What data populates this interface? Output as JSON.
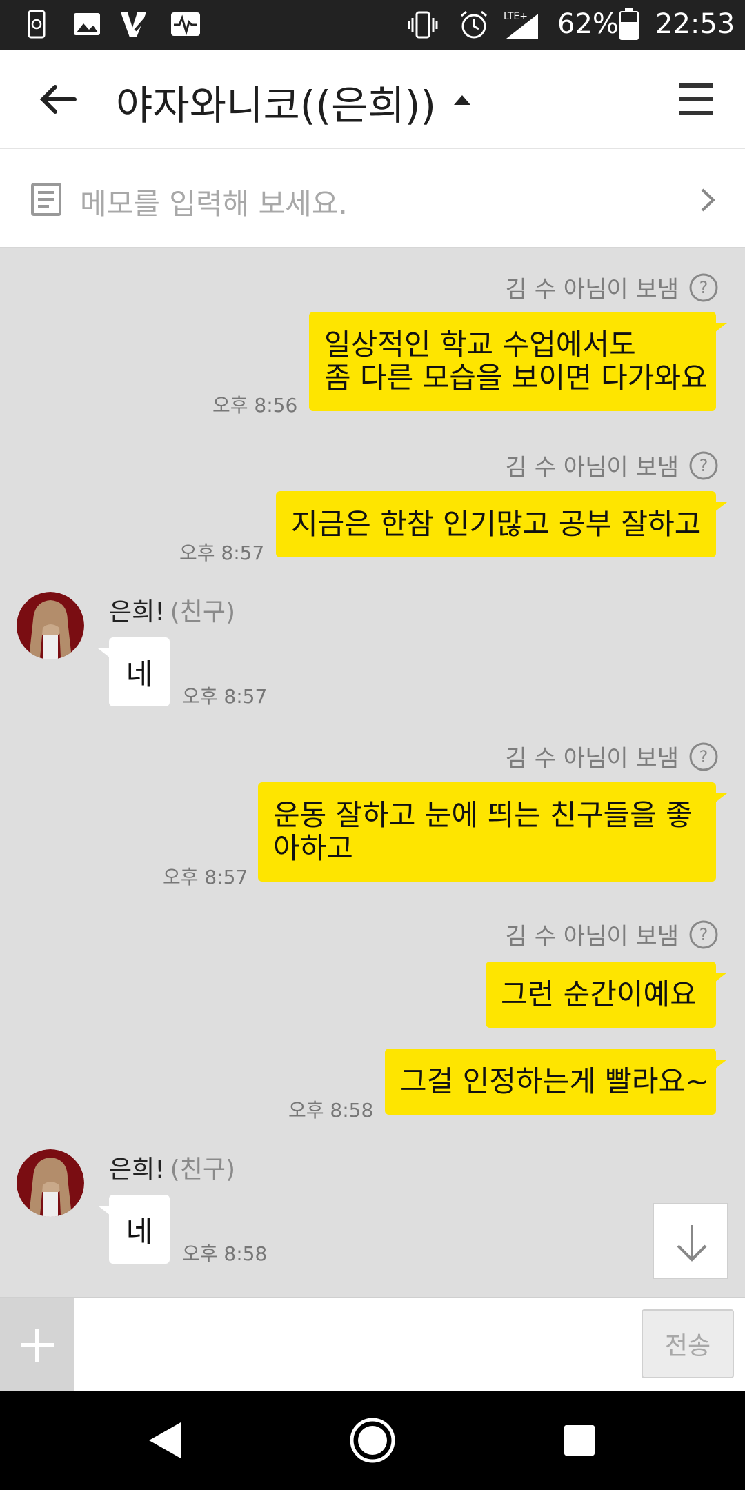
{
  "status_bar": {
    "battery": "62%",
    "time": "22:53",
    "network": "LTE+"
  },
  "header": {
    "title": "야자와니코((은희))"
  },
  "memo": {
    "placeholder": "메모를 입력해 보세요."
  },
  "messages": [
    {
      "type": "sent",
      "status": "김 수 아님이 보냄",
      "lines": [
        "일상적인 학교 수업에서도",
        "좀 다른 모습을 보이면 다가와요"
      ],
      "time": "오후 8:56"
    },
    {
      "type": "sent",
      "status": "김 수 아님이 보냄",
      "lines": [
        "지금은 한참 인기많고 공부 잘하고"
      ],
      "time": "오후 8:57"
    },
    {
      "type": "received",
      "sender": "은희!",
      "tag": "(친구)",
      "text": "네",
      "time": "오후 8:57"
    },
    {
      "type": "sent",
      "status": "김 수 아님이 보냄",
      "lines": [
        "운동 잘하고 눈에 띄는 친구들을 좋",
        "아하고"
      ],
      "time": "오후 8:57"
    },
    {
      "type": "sent",
      "status": "김 수 아님이 보냄",
      "lines": [
        "그런 순간이예요"
      ],
      "time": ""
    },
    {
      "type": "sent",
      "status": "",
      "lines": [
        "그걸 인정하는게 빨라요~"
      ],
      "time": "오후 8:58"
    },
    {
      "type": "received",
      "sender": "은희!",
      "tag": "(친구)",
      "text": "네",
      "time": "오후 8:58"
    }
  ],
  "input": {
    "value": "",
    "send_label": "전송"
  },
  "colors": {
    "my_bubble": "#fee500",
    "chat_bg": "#dedede",
    "status_bar": "#222222"
  }
}
